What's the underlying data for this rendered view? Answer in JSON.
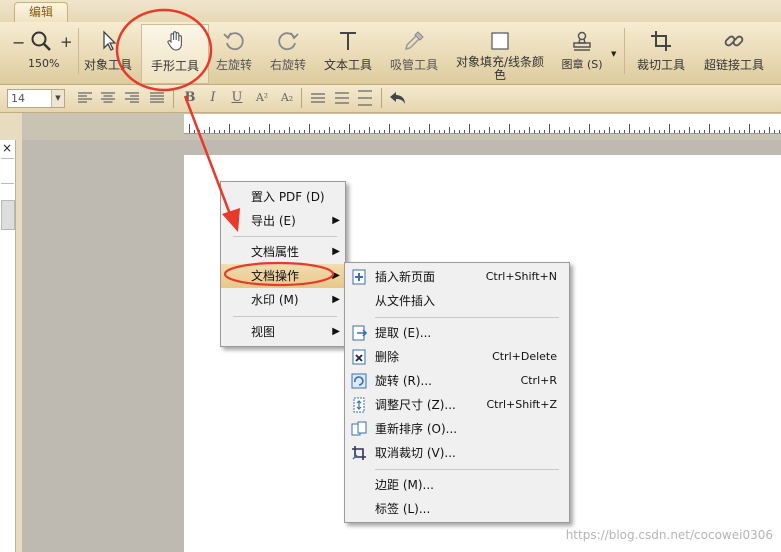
{
  "ribbon": {
    "tab_label": "编辑"
  },
  "toolbar": {
    "zoom_value": "150%",
    "zoom_minus": "−",
    "zoom_plus": "+",
    "buttons": [
      {
        "label": "对象工具"
      },
      {
        "label": "手形工具"
      },
      {
        "label": "左旋转"
      },
      {
        "label": "右旋转"
      },
      {
        "label": "文本工具"
      },
      {
        "label": "吸管工具"
      },
      {
        "label": "对象填充/线条颜色"
      },
      {
        "label": "图章 (S)"
      },
      {
        "label": "裁切工具"
      },
      {
        "label": "超链接工具"
      }
    ]
  },
  "format_bar": {
    "font_size": "14",
    "bold": "B",
    "italic": "I",
    "underline": "U",
    "superscript": "A²",
    "subscript": "A₂"
  },
  "left_panel": {
    "close_glyph": "×"
  },
  "context_menu": {
    "items": [
      {
        "label": "置入 PDF (D)"
      },
      {
        "label": "导出 (E)"
      },
      {
        "label": "文档属性"
      },
      {
        "label": "文档操作"
      },
      {
        "label": "水印 (M)"
      },
      {
        "label": "视图"
      }
    ]
  },
  "submenu": {
    "items": [
      {
        "label": "插入新页面",
        "shortcut": "Ctrl+Shift+N"
      },
      {
        "label": "从文件插入",
        "shortcut": ""
      },
      {
        "label": "提取 (E)...",
        "shortcut": ""
      },
      {
        "label": "删除",
        "shortcut": "Ctrl+Delete"
      },
      {
        "label": "旋转 (R)...",
        "shortcut": "Ctrl+R"
      },
      {
        "label": "调整尺寸 (Z)...",
        "shortcut": "Ctrl+Shift+Z"
      },
      {
        "label": "重新排序 (O)...",
        "shortcut": ""
      },
      {
        "label": "取消裁切 (V)...",
        "shortcut": ""
      },
      {
        "label": "边距 (M)...",
        "shortcut": ""
      },
      {
        "label": "标签 (L)...",
        "shortcut": ""
      }
    ]
  },
  "watermark": "https://blog.csdn.net/cocowei0306",
  "colors": {
    "annotation": "#e8392a",
    "menu_highlight": "#ecd09a"
  }
}
